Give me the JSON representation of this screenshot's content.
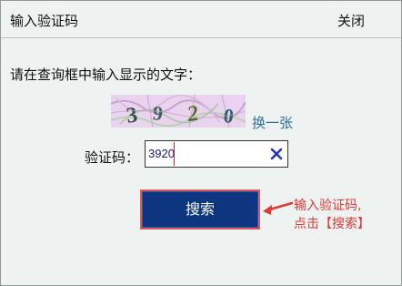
{
  "dialog": {
    "title": "输入验证码",
    "close_label": "关闭"
  },
  "prompt": "请在查询框中输入显示的文字：",
  "captcha": {
    "chars": [
      "3",
      "9",
      "2",
      "0"
    ],
    "refresh_label": "换一张"
  },
  "field": {
    "label": "验证码：",
    "value": "3920"
  },
  "search_button": "搜索",
  "annotation": {
    "line1": "输入验证码,",
    "line2": "点击【搜索】"
  },
  "colors": {
    "button_bg": "#0d3580",
    "annotation": "#e53935",
    "link": "#2f6fa3"
  }
}
